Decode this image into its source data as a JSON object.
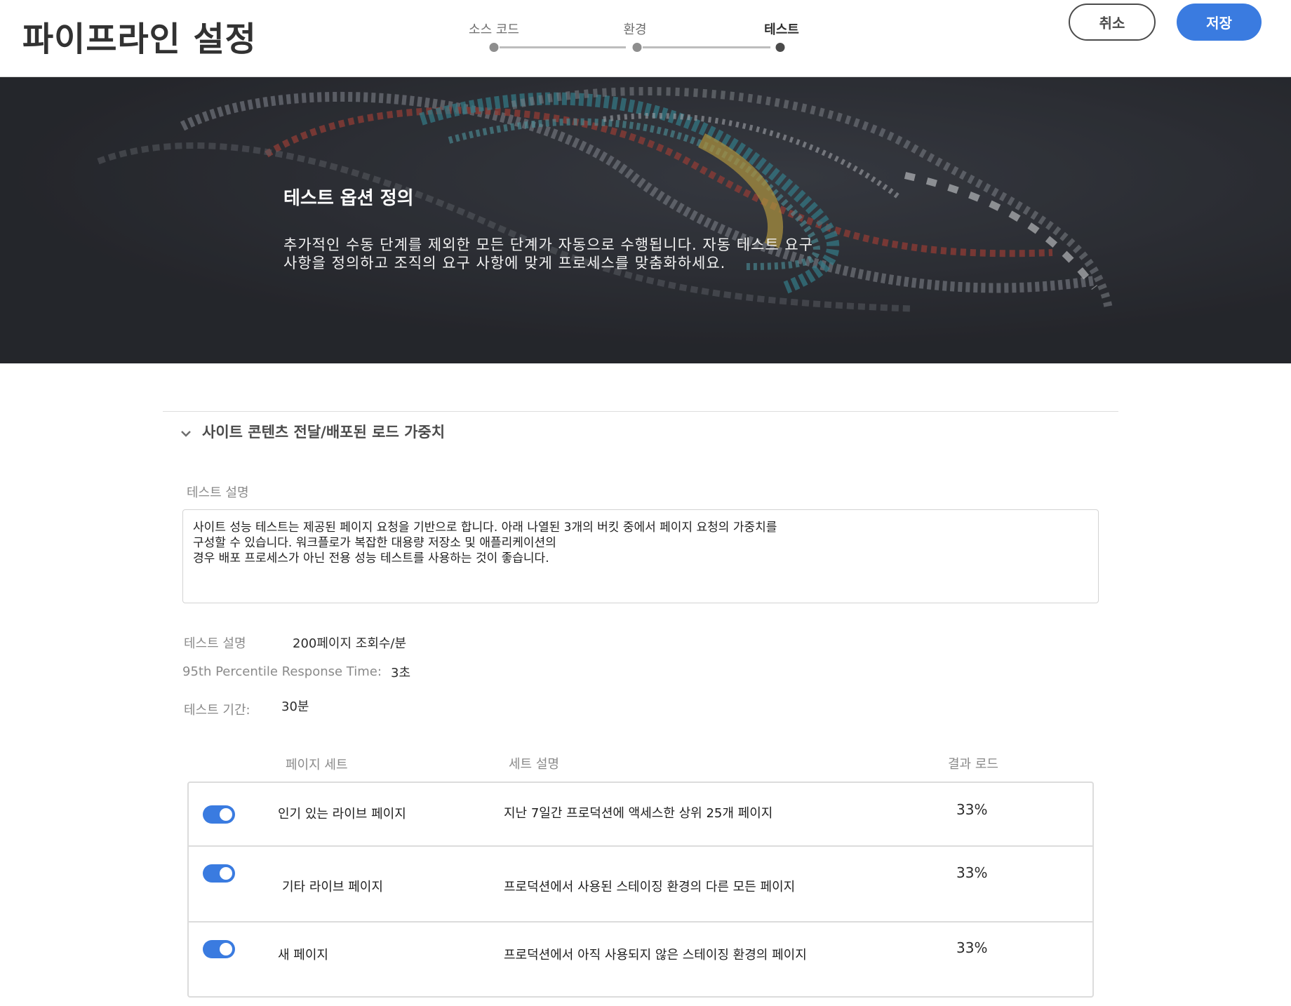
{
  "header": {
    "title": "파이프라인 설정",
    "steps": [
      "소스 코드",
      "환경",
      "테스트"
    ],
    "active_step": 2,
    "cancel_label": "취소",
    "save_label": "저장"
  },
  "hero": {
    "title": "테스트 옵션 정의",
    "description_line1": "추가적인 수동 단계를 제외한 모든 단계가 자동으로 수행됩니다. 자동 테스트 요구",
    "description_line2": "사항을 정의하고 조직의 요구 사항에 맞게 프로세스를 맞춤화하세요."
  },
  "section": {
    "title": "사이트 콘텐츠 전달/배포된 로드 가중치",
    "expanded": true,
    "test_description_label": "테스트 설명",
    "test_description_text": "사이트 성능 테스트는 제공된 페이지 요청을 기반으로 합니다. 아래 나열된 3개의 버킷 중에서 페이지 요청의 가중치를\n구성할 수 있습니다. 워크플로가 복잡한 대용량 저장소 및 애플리케이션의\n경우 배포 프로세스가 아닌 전용 성능 테스트를 사용하는 것이 좋습니다.",
    "rate_label": "테스트 설명",
    "rate_value": "200페이지 조회수/분",
    "response_label": "95th Percentile Response Time:",
    "response_value": "3초",
    "duration_label": "테스트 기간:",
    "duration_value": "30분"
  },
  "table": {
    "headers": [
      "페이지 세트",
      "세트 설명",
      "결과 로드"
    ],
    "rows": [
      {
        "enabled": true,
        "name": "인기 있는 라이브 페이지",
        "description": "지난 7일간 프로덕션에 액세스한 상위 25개 페이지",
        "load": "33%"
      },
      {
        "enabled": true,
        "name": "기타 라이브 페이지",
        "description": "프로덕션에서 사용된 스테이징 환경의 다른 모든 페이지",
        "load": "33%"
      },
      {
        "enabled": true,
        "name": "새 페이지",
        "description": "프로덕션에서 아직 사용되지 않은 스테이징 환경의 페이지",
        "load": "33%"
      }
    ]
  },
  "colors": {
    "accent": "#3a7be0",
    "hero_bg": "#2a2c31"
  },
  "icons": {
    "accordion": "chevron-down-icon"
  }
}
